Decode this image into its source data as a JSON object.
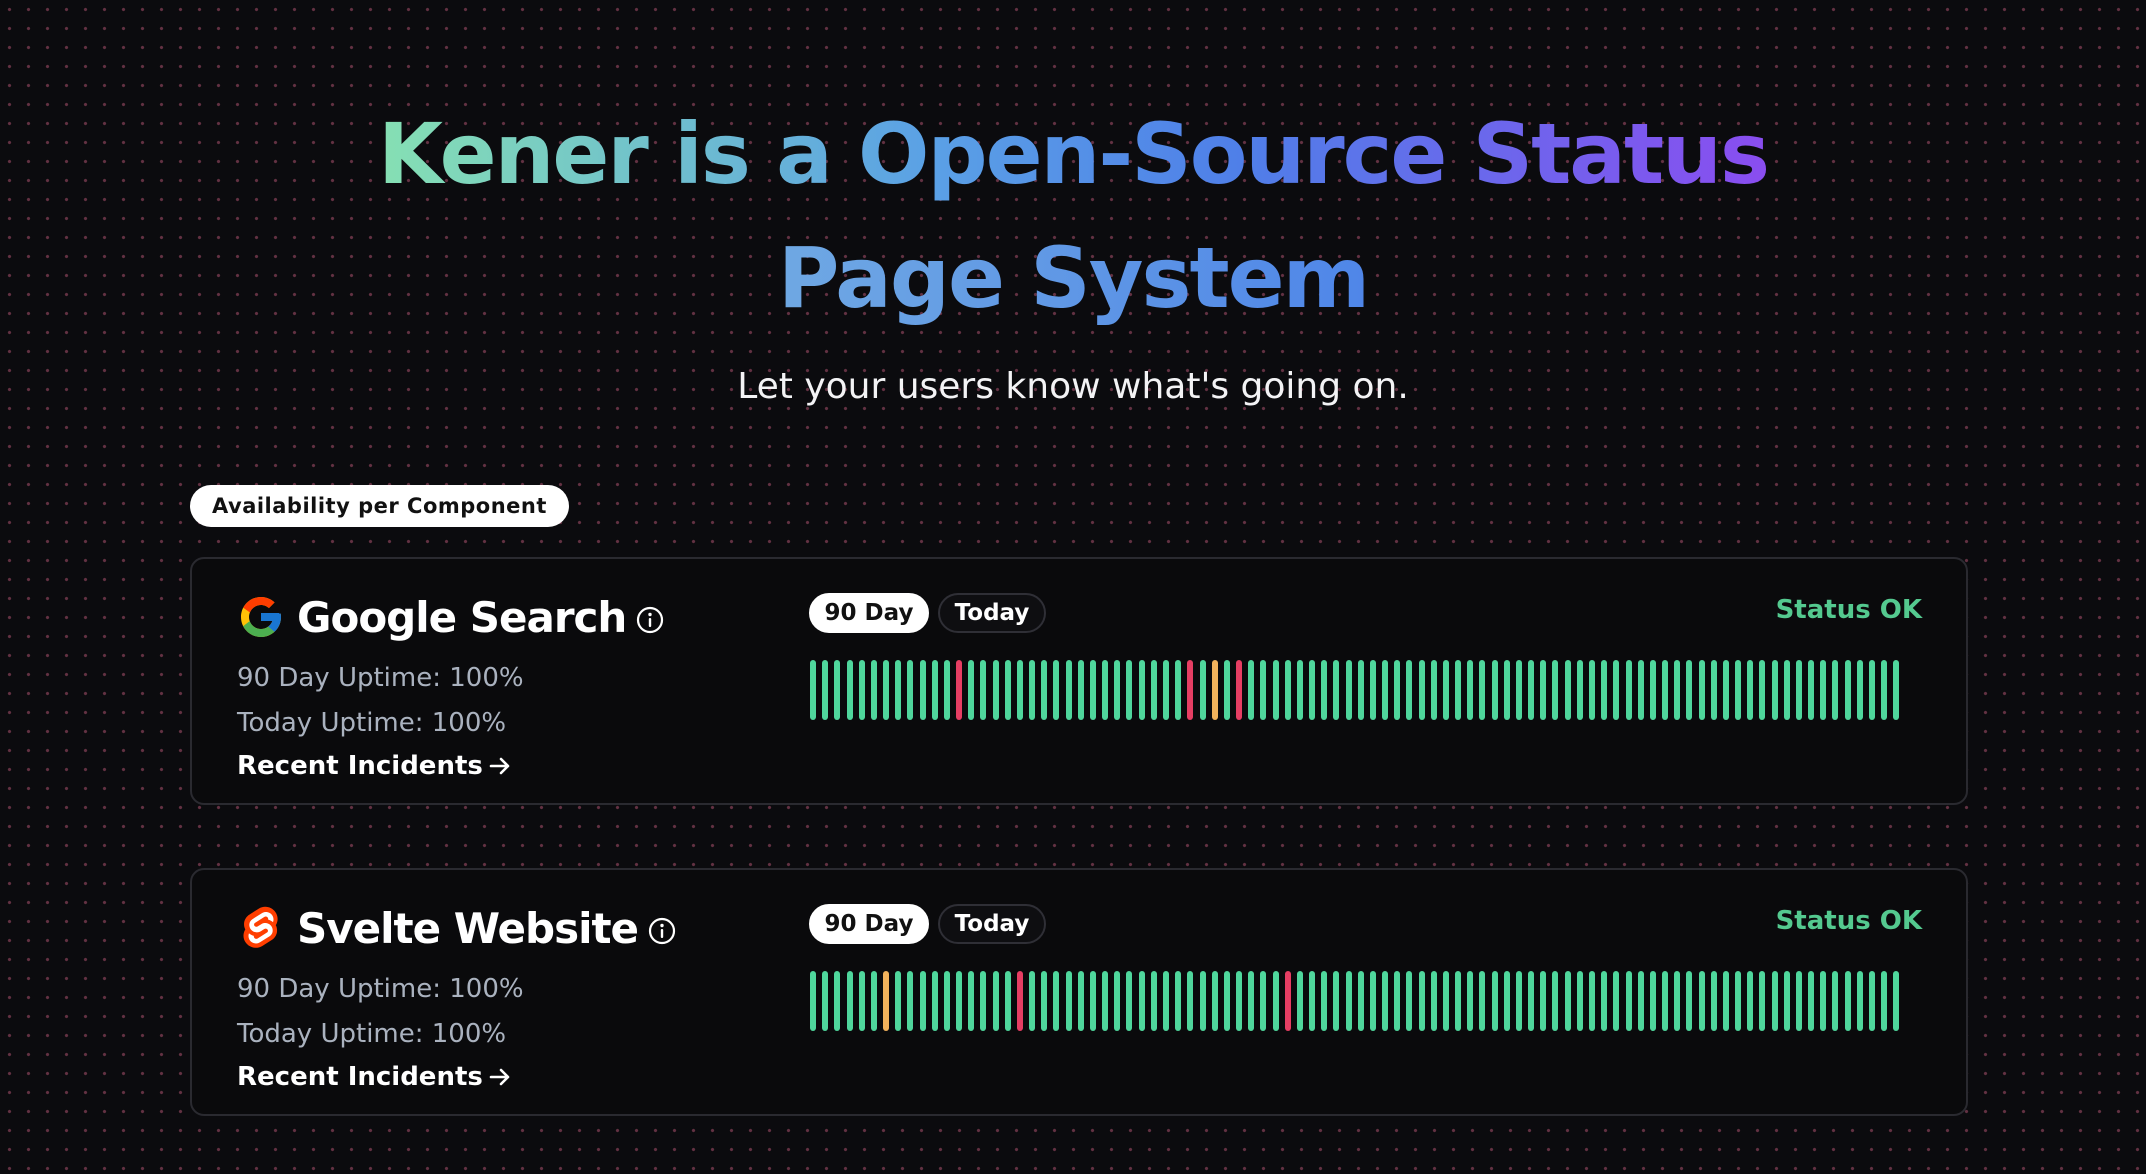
{
  "hero": {
    "title_part1": "Kener is a Open-Source Status",
    "title_part2": "Page System",
    "subtitle": "Let your users know what's going on."
  },
  "section_label": "Availability per Component",
  "colors": {
    "up": "#4fd69c",
    "down": "#e63e63",
    "degraded": "#f2b25c",
    "status_ok": "#54c98f"
  },
  "monitors": [
    {
      "name": "Google Search",
      "logo": "google-logo",
      "uptime_90_label": "90 Day Uptime: 100%",
      "uptime_today_label": "Today Uptime: 100%",
      "incidents_label": "Recent Incidents",
      "tab_90": "90 Day",
      "tab_today": "Today",
      "status": "Status OK",
      "days": [
        "up",
        "up",
        "up",
        "up",
        "up",
        "up",
        "up",
        "up",
        "up",
        "up",
        "up",
        "up",
        "down",
        "up",
        "up",
        "up",
        "up",
        "up",
        "up",
        "up",
        "up",
        "up",
        "up",
        "up",
        "up",
        "up",
        "up",
        "up",
        "up",
        "up",
        "up",
        "down",
        "up",
        "degraded",
        "up",
        "down",
        "up",
        "up",
        "up",
        "up",
        "up",
        "up",
        "up",
        "up",
        "up",
        "up",
        "up",
        "up",
        "up",
        "up",
        "up",
        "up",
        "up",
        "up",
        "up",
        "up",
        "up",
        "up",
        "up",
        "up",
        "up",
        "up",
        "up",
        "up",
        "up",
        "up",
        "up",
        "up",
        "up",
        "up",
        "up",
        "up",
        "up",
        "up",
        "up",
        "up",
        "up",
        "up",
        "up",
        "up",
        "up",
        "up",
        "up",
        "up",
        "up",
        "up",
        "up",
        "up",
        "up",
        "up"
      ]
    },
    {
      "name": "Svelte Website",
      "logo": "svelte-logo",
      "uptime_90_label": "90 Day Uptime: 100%",
      "uptime_today_label": "Today Uptime: 100%",
      "incidents_label": "Recent Incidents",
      "tab_90": "90 Day",
      "tab_today": "Today",
      "status": "Status OK",
      "days": [
        "up",
        "up",
        "up",
        "up",
        "up",
        "up",
        "degraded",
        "up",
        "up",
        "up",
        "up",
        "up",
        "up",
        "up",
        "up",
        "up",
        "up",
        "down",
        "up",
        "up",
        "up",
        "up",
        "up",
        "up",
        "up",
        "up",
        "up",
        "up",
        "up",
        "up",
        "up",
        "up",
        "up",
        "up",
        "up",
        "up",
        "up",
        "up",
        "up",
        "down",
        "up",
        "up",
        "up",
        "up",
        "up",
        "up",
        "up",
        "up",
        "up",
        "up",
        "up",
        "up",
        "up",
        "up",
        "up",
        "up",
        "up",
        "up",
        "up",
        "up",
        "up",
        "up",
        "up",
        "up",
        "up",
        "up",
        "up",
        "up",
        "up",
        "up",
        "up",
        "up",
        "up",
        "up",
        "up",
        "up",
        "up",
        "up",
        "up",
        "up",
        "up",
        "up",
        "up",
        "up",
        "up",
        "up",
        "up",
        "up",
        "up",
        "up"
      ]
    }
  ]
}
